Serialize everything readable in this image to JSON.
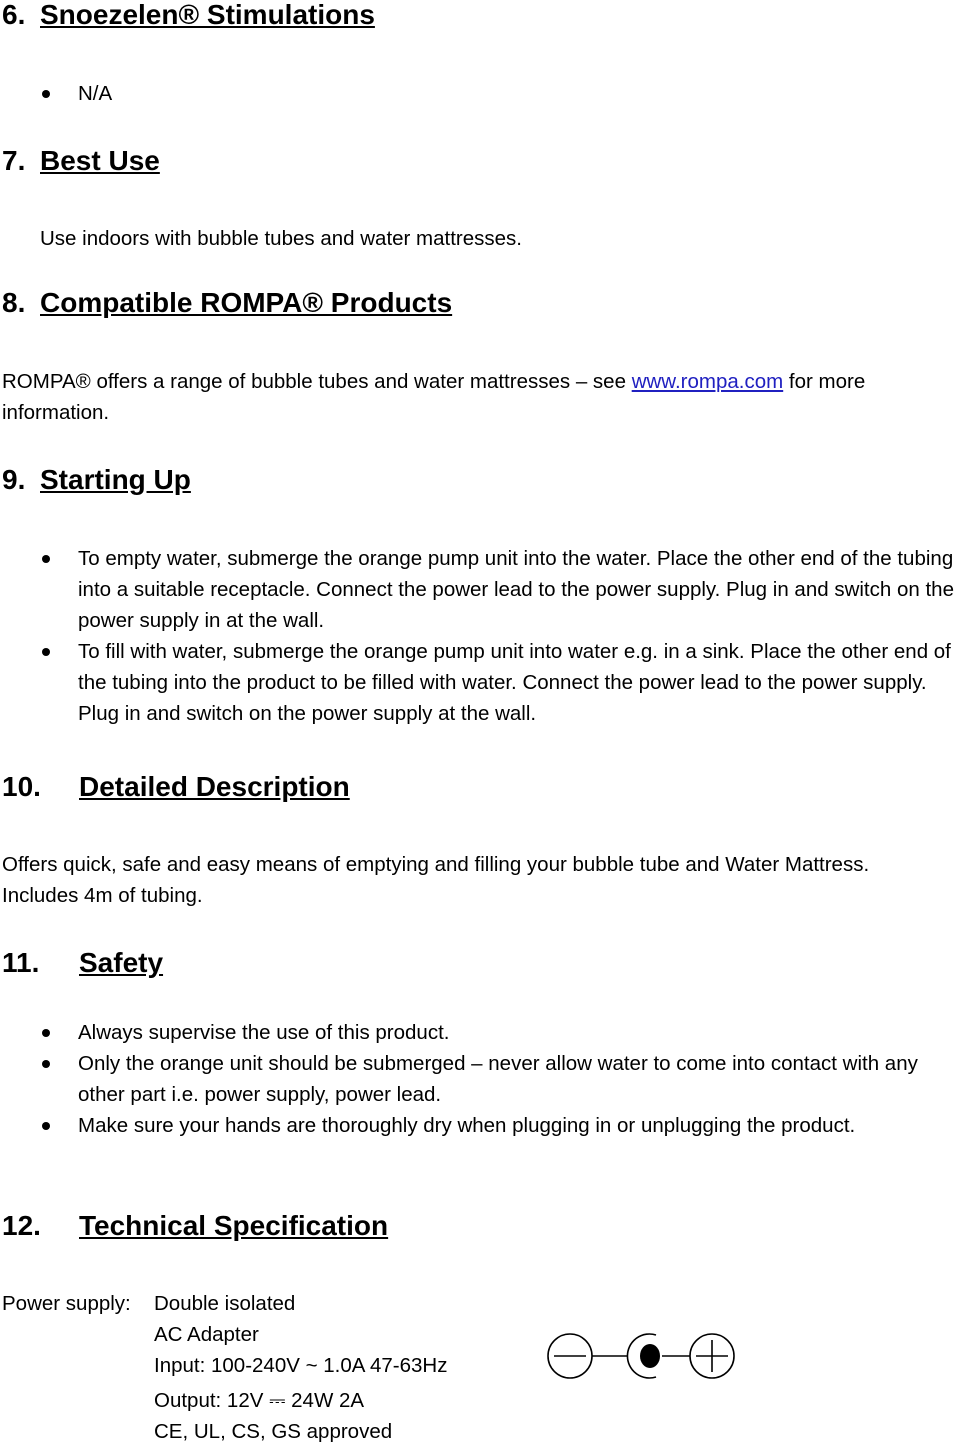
{
  "sections": [
    {
      "num": "6.",
      "title": "Snoezelen® Stimulations",
      "bullets": [
        "N/A"
      ]
    },
    {
      "num": "7.",
      "title": "Best Use",
      "text": "Use indoors with bubble tubes and water mattresses."
    },
    {
      "num": "8.",
      "title": "Compatible ROMPA® Products",
      "text_before": "ROMPA® offers a range of bubble tubes and water mattresses – see ",
      "link": "www.rompa.com",
      "text_after": " for more information."
    },
    {
      "num": "9.",
      "title": "Starting Up",
      "bullets": [
        "To empty water, submerge the orange pump unit into the water.  Place the other end of the tubing into a suitable receptacle.  Connect the power lead to the power supply.  Plug in and switch on the power supply in at the wall.",
        "To fill with water, submerge the orange pump unit into water e.g. in a sink.  Place the other end of the tubing into the product to be filled with water. Connect the power lead to the power supply. Plug in and switch on the power supply at the wall."
      ]
    },
    {
      "num": "10.",
      "title": "Detailed Description",
      "text": "Offers quick, safe and easy means of emptying and filling your bubble tube and Water Mattress.  Includes 4m of tubing."
    },
    {
      "num": "11.",
      "title": "Safety",
      "bullets": [
        "Always supervise the use of this product.",
        "Only the orange unit should be submerged – never allow water to come into contact with any other part i.e. power supply, power lead.",
        "Make sure your hands are thoroughly dry when plugging in or unplugging the product."
      ]
    },
    {
      "num": "12.",
      "title": "Technical Specification"
    }
  ],
  "spec": {
    "label": "Power supply: ",
    "lines": [
      "Double isolated",
      "AC Adapter",
      "Input: 100-240V ~ 1.0A   47-63Hz",
      "Output: 12V ⎓ 24W 2A",
      "CE, UL, CS, GS approved"
    ]
  },
  "polarity_icon": "center-positive-polarity-symbol"
}
